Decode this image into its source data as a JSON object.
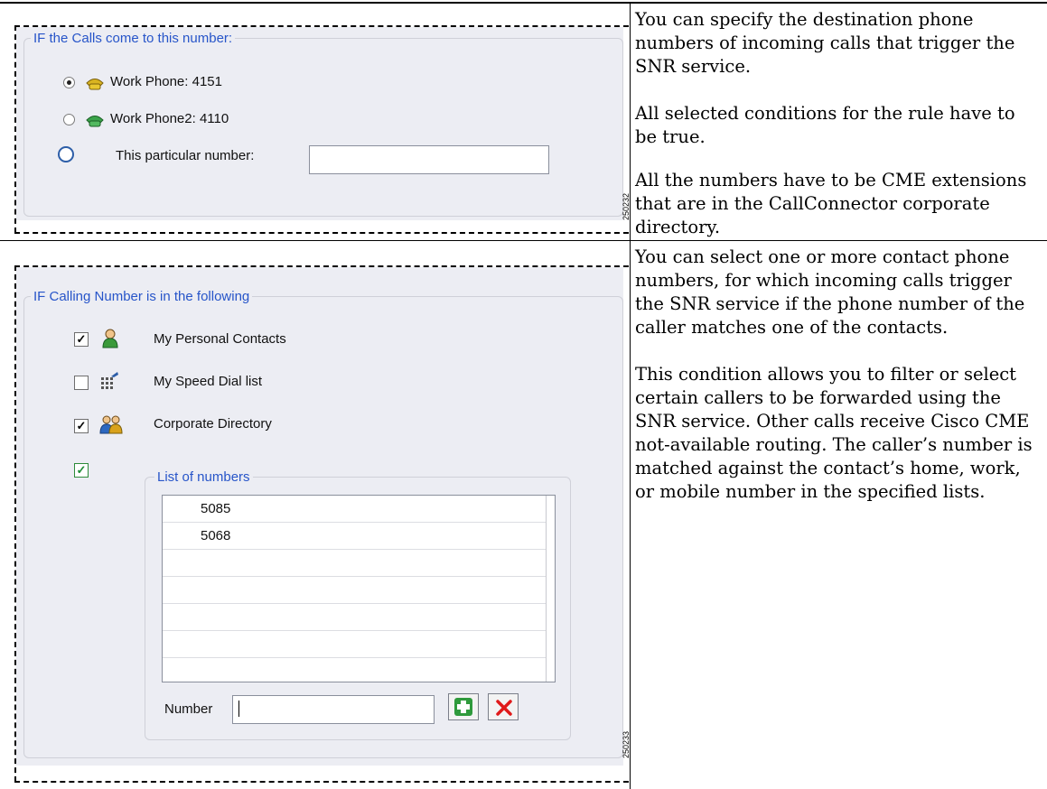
{
  "row1": {
    "group_title": "IF the Calls come to this number:",
    "options": [
      {
        "label": "Work Phone: 4151",
        "selected": true,
        "icon": "yellow-phone-icon"
      },
      {
        "label": "Work Phone2: 4110",
        "selected": false,
        "icon": "green-phone-icon"
      },
      {
        "label": "This particular number:",
        "selected": false,
        "icon": ""
      }
    ],
    "particular_number_value": "",
    "figure_number": "250232",
    "description": [
      "You can specify the destination phone numbers of incoming calls that trigger the SNR service.",
      "All selected conditions for the rule have to be true.",
      "All the numbers have to be CME extensions that are in the CallConnector corporate directory."
    ]
  },
  "row2": {
    "group_title": "IF Calling Number is in the following",
    "lists": [
      {
        "label": "My Personal Contacts",
        "checked": true,
        "icon": "person-icon"
      },
      {
        "label": "My Speed Dial list",
        "checked": false,
        "icon": "speed-dial-icon"
      },
      {
        "label": "Corporate Directory",
        "checked": true,
        "icon": "people-icon"
      }
    ],
    "list_of_numbers_checked": true,
    "list_title": "List of numbers",
    "numbers": [
      "5085",
      "5068",
      "",
      "",
      "",
      "",
      ""
    ],
    "number_label": "Number",
    "number_value": "",
    "add_icon": "green-plus-icon",
    "delete_icon": "red-x-icon",
    "figure_number": "250233",
    "description": [
      "You can select one or more contact phone numbers, for which incoming calls trigger the SNR service if the phone number of the caller matches one of the contacts.",
      "This condition allows you to filter or select certain callers to be forwarded using the SNR service. Other calls receive Cisco CME not-available routing. The caller’s number is matched against the contact’s home, work, or mobile number in the specified lists."
    ]
  }
}
